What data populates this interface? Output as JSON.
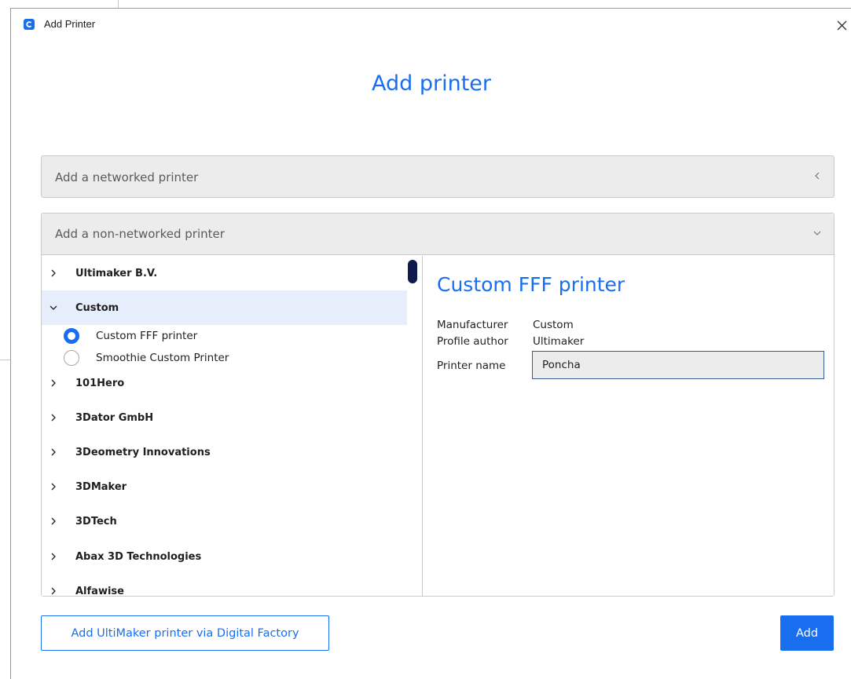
{
  "window": {
    "title": "Add Printer"
  },
  "heading": "Add printer",
  "networked": {
    "label": "Add a networked printer",
    "state": "collapsed"
  },
  "non_networked": {
    "label": "Add a non-networked printer",
    "state": "expanded",
    "tree": [
      {
        "label": "Ultimaker B.V.",
        "expanded": false
      },
      {
        "label": "Custom",
        "expanded": true,
        "selected": true
      },
      {
        "label": "101Hero",
        "expanded": false
      },
      {
        "label": "3Dator GmbH",
        "expanded": false
      },
      {
        "label": "3Deometry Innovations",
        "expanded": false
      },
      {
        "label": "3DMaker",
        "expanded": false
      },
      {
        "label": "3DTech",
        "expanded": false
      },
      {
        "label": "Abax 3D Technologies",
        "expanded": false
      },
      {
        "label": "Alfawise",
        "expanded": false
      }
    ],
    "custom_options": [
      {
        "label": "Custom FFF printer",
        "checked": true
      },
      {
        "label": "Smoothie Custom Printer",
        "checked": false
      }
    ]
  },
  "detail": {
    "title": "Custom FFF printer",
    "manufacturer_label": "Manufacturer",
    "manufacturer_value": "Custom",
    "author_label": "Profile author",
    "author_value": "Ultimaker",
    "name_label": "Printer name",
    "name_value": "Poncha"
  },
  "buttons": {
    "digital_factory": "Add UltiMaker printer via Digital Factory",
    "add": "Add"
  },
  "colors": {
    "accent": "#196ef0",
    "selected_row": "#e6eefc",
    "scroll_thumb": "#0f1a4d"
  }
}
